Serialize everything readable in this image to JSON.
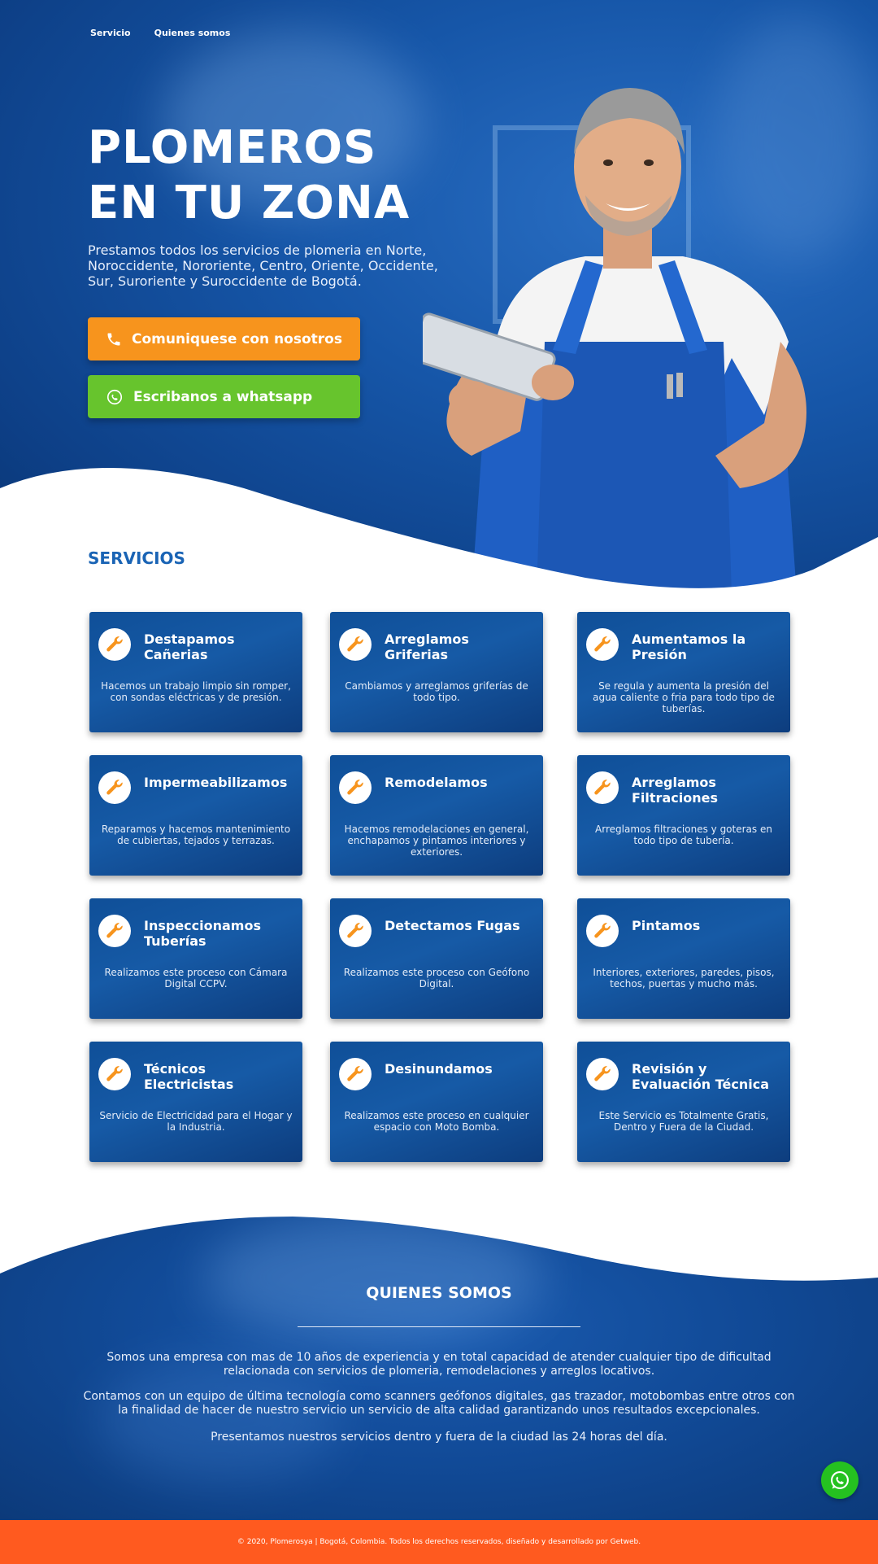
{
  "nav": {
    "items": [
      "Servicio",
      "Quienes somos"
    ]
  },
  "hero": {
    "title_line1": "PLOMEROS",
    "title_line2": "EN TU ZONA",
    "description": "Prestamos todos los servicios de plomeria en Norte, Noroccidente, Nororiente, Centro, Oriente, Occidente, Sur, Suroriente y Suroccidente de Bogotá.",
    "call_button": "Comuniquese con nosotros",
    "whatsapp_button": "Escribanos a whatsapp"
  },
  "services": {
    "title": "SERVICIOS",
    "items": [
      {
        "title": "Destapamos Cañerias",
        "desc": "Hacemos un trabajo limpio sin romper, con sondas eléctricas y de presión."
      },
      {
        "title": "Arreglamos Griferias",
        "desc": "Cambiamos y arreglamos griferías de todo tipo."
      },
      {
        "title": "Aumentamos la Presión",
        "desc": "Se regula y aumenta la presión del agua caliente o fria para todo tipo de tuberías."
      },
      {
        "title": "Impermeabilizamos",
        "desc": "Reparamos y hacemos mantenimiento de cubiertas, tejados y terrazas."
      },
      {
        "title": "Remodelamos",
        "desc": "Hacemos remodelaciones en general, enchapamos y pintamos interiores y exteriores."
      },
      {
        "title": "Arreglamos Filtraciones",
        "desc": "Arreglamos filtraciones y goteras en todo tipo de tubería."
      },
      {
        "title": "Inspeccionamos Tuberías",
        "desc": "Realizamos este proceso con Cámara Digital CCPV."
      },
      {
        "title": "Detectamos Fugas",
        "desc": "Realizamos este proceso con Geófono Digital."
      },
      {
        "title": "Pintamos",
        "desc": "Interiores, exteriores, paredes, pisos, techos, puertas y mucho más."
      },
      {
        "title": "Técnicos Electricistas",
        "desc": "Servicio de Electricidad para el Hogar y la Industria."
      },
      {
        "title": "Desinundamos",
        "desc": "Realizamos este proceso en cualquier espacio con Moto Bomba."
      },
      {
        "title": "Revisión y Evaluación Técnica",
        "desc": "Este Servicio es Totalmente Gratis, Dentro y Fuera de la Ciudad."
      }
    ]
  },
  "about": {
    "title": "QUIENES SOMOS",
    "p1": "Somos una empresa con mas de 10 años de experiencia y en total capacidad de atender cualquier tipo de dificultad relacionada con servicios de plomeria, remodelaciones y arreglos locativos.",
    "p2": "Contamos con un equipo de última tecnología como scanners geófonos digitales, gas trazador, motobombas entre otros con la finalidad de hacer de nuestro servicio un servicio de alta calidad garantizando unos resultados excepcionales.",
    "p3": "Presentamos nuestros servicios dentro y fuera de la ciudad las 24 horas del día."
  },
  "footer": {
    "text": "© 2020, Plomerosya | Bogotá, Colombia. Todos los derechos reservados, diseñado y desarrollado por Getweb."
  },
  "colors": {
    "primary_blue": "#1656a8",
    "orange": "#f7941d",
    "green": "#67c42d",
    "footer_orange": "#ff5a1f",
    "whatsapp_green": "#25c120"
  }
}
